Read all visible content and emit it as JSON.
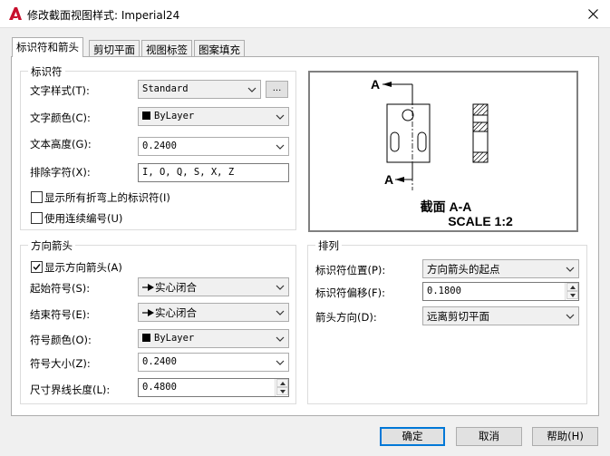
{
  "window": {
    "title": "修改截面视图样式: Imperial24"
  },
  "tabs": [
    {
      "label": "标识符和箭头",
      "active": true
    },
    {
      "label": "剪切平面",
      "active": false
    },
    {
      "label": "视图标签",
      "active": false
    },
    {
      "label": "图案填充",
      "active": false
    }
  ],
  "identifier": {
    "group_title": "标识符",
    "text_style_label": "文字样式(T):",
    "text_style_value": "Standard",
    "browse_label": "...",
    "text_color_label": "文字颜色(C):",
    "text_color_value": "ByLayer",
    "text_height_label": "文本高度(G):",
    "text_height_value": "0.2400",
    "exclude_label": "排除字符(X):",
    "exclude_value": "I, O, Q, S, X, Z",
    "show_all_bends_label": "显示所有折弯上的标识符(I)",
    "show_all_bends_checked": false,
    "continuous_label": "使用连续编号(U)",
    "continuous_checked": false
  },
  "direction": {
    "group_title": "方向箭头",
    "show_arrows_label": "显示方向箭头(A)",
    "show_arrows_checked": true,
    "start_symbol_label": "起始符号(S):",
    "start_symbol_value": "实心闭合",
    "end_symbol_label": "结束符号(E):",
    "end_symbol_value": "实心闭合",
    "symbol_color_label": "符号颜色(O):",
    "symbol_color_value": "ByLayer",
    "symbol_size_label": "符号大小(Z):",
    "symbol_size_value": "0.2400",
    "ext_length_label": "尺寸界线长度(L):",
    "ext_length_value": "0.4800"
  },
  "preview": {
    "label_top": "A",
    "label_bottom": "A",
    "section_caption": "截面 A-A",
    "scale_caption": "SCALE 1:2"
  },
  "arrangement": {
    "group_title": "排列",
    "id_position_label": "标识符位置(P):",
    "id_position_value": "方向箭头的起点",
    "id_offset_label": "标识符偏移(F):",
    "id_offset_value": "0.1800",
    "arrow_dir_label": "箭头方向(D):",
    "arrow_dir_value": "远离剪切平面"
  },
  "buttons": {
    "ok": "确定",
    "cancel": "取消",
    "help": "帮助(H)"
  },
  "colors": {
    "app_icon": "#c8102e",
    "default_button_border": "#0078d7"
  }
}
